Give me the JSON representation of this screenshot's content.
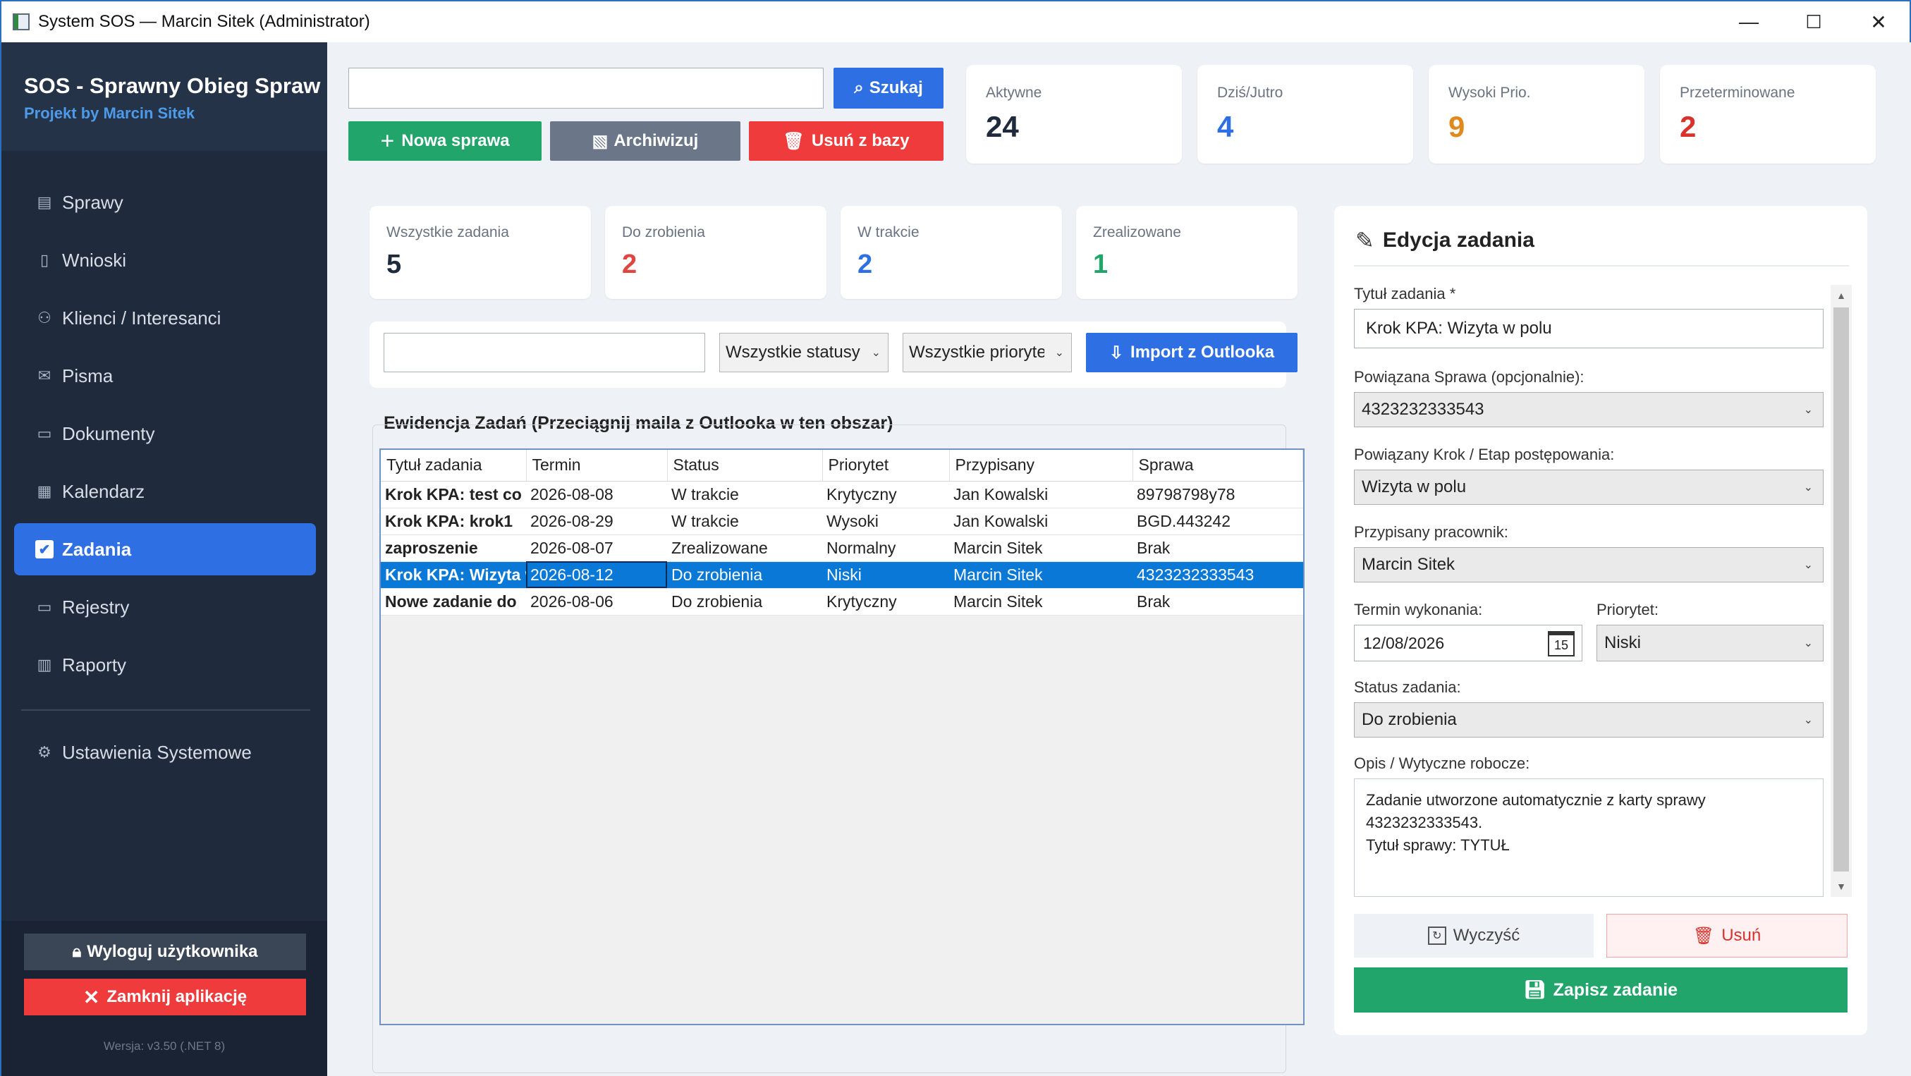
{
  "window": {
    "title": "System SOS — Marcin Sitek (Administrator)",
    "minimize": "—",
    "maximize": "☐",
    "close": "✕"
  },
  "sidebar": {
    "brand_title": "SOS - Sprawny Obieg Spraw",
    "brand_subtitle": "Projekt by Marcin Sitek",
    "items": [
      {
        "label": "Sprawy",
        "icon": "cases-icon"
      },
      {
        "label": "Wnioski",
        "icon": "document-icon"
      },
      {
        "label": "Klienci / Interesanci",
        "icon": "people-icon"
      },
      {
        "label": "Pisma",
        "icon": "mail-icon"
      },
      {
        "label": "Dokumenty",
        "icon": "folder-icon"
      },
      {
        "label": "Kalendarz",
        "icon": "calendar-icon"
      },
      {
        "label": "Zadania",
        "icon": "checkbox-icon",
        "active": true
      },
      {
        "label": "Rejestry",
        "icon": "register-icon"
      },
      {
        "label": "Raporty",
        "icon": "chart-icon"
      }
    ],
    "settings_label": "Ustawienia Systemowe",
    "logout_label": "Wyloguj użytkownika",
    "close_app_label": "Zamknij aplikację",
    "version": "Wersja: v3.50 (.NET 8)"
  },
  "toolbar": {
    "search_value": "",
    "search_label": "Szukaj",
    "new_case_label": "Nowa sprawa",
    "archive_label": "Archiwizuj",
    "delete_label": "Usuń z bazy"
  },
  "stats": [
    {
      "label": "Aktywne",
      "value": "24",
      "color": "#1f2a3d"
    },
    {
      "label": "Dziś/Jutro",
      "value": "4",
      "color": "#2f6fe4"
    },
    {
      "label": "Wysoki Prio.",
      "value": "9",
      "color": "#e08a1e"
    },
    {
      "label": "Przeterminowane",
      "value": "2",
      "color": "#d9312b"
    }
  ],
  "task_stats": [
    {
      "label": "Wszystkie zadania",
      "value": "5",
      "color": "#1f2a3d"
    },
    {
      "label": "Do zrobienia",
      "value": "2",
      "color": "#e0453f"
    },
    {
      "label": "W trakcie",
      "value": "2",
      "color": "#2f6fe4"
    },
    {
      "label": "Zrealizowane",
      "value": "1",
      "color": "#22a56a"
    }
  ],
  "filters": {
    "search_value": "",
    "status_selected": "Wszystkie statusy",
    "priority_selected": "Wszystkie priorytety",
    "import_label": "Import z Outlooka"
  },
  "table": {
    "caption": "Ewidencja Zadań (Przeciągnij maila z Outlooka w ten obszar)",
    "columns": [
      "Tytuł zadania",
      "Termin",
      "Status",
      "Priorytet",
      "Przypisany",
      "Sprawa"
    ],
    "rows": [
      [
        "Krok KPA: test co tam",
        "2026-08-08",
        "W trakcie",
        "Krytyczny",
        "Jan Kowalski",
        "89798798y78"
      ],
      [
        "Krok KPA: krok1",
        "2026-08-29",
        "W trakcie",
        "Wysoki",
        "Jan Kowalski",
        "BGD.443242"
      ],
      [
        "zaproszenie",
        "2026-08-07",
        "Zrealizowane",
        "Normalny",
        "Marcin Sitek",
        "Brak"
      ],
      [
        "Krok KPA: Wizyta w polu",
        "2026-08-12",
        "Do zrobienia",
        "Niski",
        "Marcin Sitek",
        "4323232333543"
      ],
      [
        "Nowe zadanie do",
        "2026-08-06",
        "Do zrobienia",
        "Krytyczny",
        "Marcin Sitek",
        "Brak"
      ]
    ],
    "selected_row": 3
  },
  "editor": {
    "heading": "Edycja zadania",
    "title_label": "Tytuł zadania *",
    "title_value": "Krok KPA: Wizyta w polu",
    "case_label": "Powiązana Sprawa (opcjonalnie):",
    "case_value": "4323232333543",
    "step_label": "Powiązany Krok / Etap postępowania:",
    "step_value": "Wizyta w polu",
    "assignee_label": "Przypisany pracownik:",
    "assignee_value": "Marcin Sitek",
    "due_label": "Termin wykonania:",
    "due_value": "12/08/2026",
    "calendar_day": "15",
    "priority_label": "Priorytet:",
    "priority_value": "Niski",
    "status_label": "Status zadania:",
    "status_value": "Do zrobienia",
    "desc_label": "Opis / Wytyczne robocze:",
    "desc_line1": "Zadanie utworzone automatycznie z karty sprawy",
    "desc_line2": "4323232333543.",
    "desc_line3": "Tytuł sprawy: TYTUŁ",
    "clear_label": "Wyczyść",
    "delete_label": "Usuń",
    "save_label": "Zapisz zadanie"
  }
}
